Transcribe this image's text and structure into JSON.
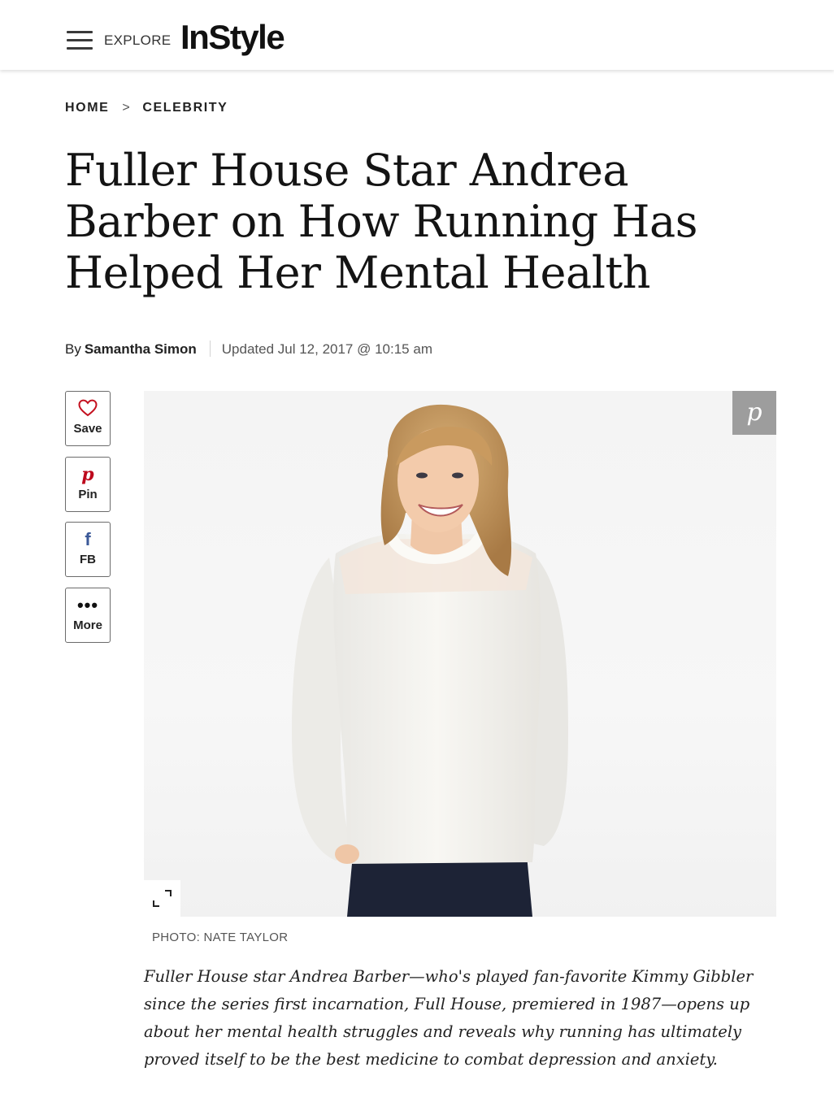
{
  "header": {
    "explore_label": "EXPLORE",
    "logo_text": "InStyle"
  },
  "breadcrumb": {
    "home": "HOME",
    "separator": ">",
    "section": "CELEBRITY"
  },
  "article": {
    "title": "Fuller House Star Andrea Barber on How Running Has Helped Her Mental Health",
    "by_label": "By",
    "author": "Samantha Simon",
    "updated": "Updated Jul 12, 2017 @ 10:15 am",
    "photo_credit": "PHOTO: NATE TAYLOR",
    "dek": "Fuller House star Andrea Barber—who's played fan-favorite Kimmy Gibbler since the series first incarnation, Full House, premiered in 1987—opens up about her mental health struggles and reveals why running has ultimately proved itself to be the best medicine to combat depression and anxiety."
  },
  "share": {
    "save_label": "Save",
    "pin_label": "Pin",
    "fb_label": "FB",
    "more_label": "More"
  },
  "colors": {
    "save_icon": "#c4111f",
    "pin_icon": "#bd081c",
    "fb_icon": "#3b5998",
    "pin_overlay": "#9d9d9d"
  },
  "icons": {
    "menu": "hamburger-icon",
    "save": "heart-icon",
    "pin": "pinterest-icon",
    "fb": "facebook-icon",
    "more": "ellipsis-icon",
    "expand": "expand-icon"
  }
}
